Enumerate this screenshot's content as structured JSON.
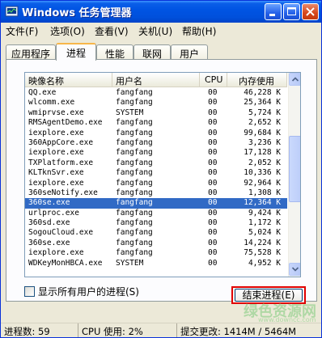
{
  "window": {
    "title": "Windows 任务管理器"
  },
  "title_buttons": {
    "minimize": "minimize-icon",
    "maximize": "maximize-icon",
    "close": "close-icon"
  },
  "menu": [
    "文件(F)",
    "选项(O)",
    "查看(V)",
    "关机(U)",
    "帮助(H)"
  ],
  "tabs": [
    "应用程序",
    "进程",
    "性能",
    "联网",
    "用户"
  ],
  "active_tab": "进程",
  "columns": [
    "映像名称",
    "用户名",
    "CPU",
    "内存使用"
  ],
  "rows": [
    [
      "QQ.exe",
      "fangfang",
      "00",
      "46,228 K"
    ],
    [
      "wlcomm.exe",
      "fangfang",
      "00",
      "25,364 K"
    ],
    [
      "wmiprvse.exe",
      "SYSTEM",
      "00",
      "5,724 K"
    ],
    [
      "RMSAgentDemo.exe",
      "fangfang",
      "00",
      "2,652 K"
    ],
    [
      "iexplore.exe",
      "fangfang",
      "00",
      "99,684 K"
    ],
    [
      "360AppCore.exe",
      "fangfang",
      "00",
      "3,236 K"
    ],
    [
      "iexplore.exe",
      "fangfang",
      "00",
      "17,128 K"
    ],
    [
      "TXPlatform.exe",
      "fangfang",
      "00",
      "2,052 K"
    ],
    [
      "KLTknSvr.exe",
      "fangfang",
      "00",
      "10,336 K"
    ],
    [
      "iexplore.exe",
      "fangfang",
      "00",
      "92,964 K"
    ],
    [
      "360seNotify.exe",
      "fangfang",
      "00",
      "1,308 K"
    ],
    [
      "360se.exe",
      "fangfang",
      "00",
      "12,364 K"
    ],
    [
      "urlproc.exe",
      "fangfang",
      "00",
      "9,424 K"
    ],
    [
      "360sd.exe",
      "fangfang",
      "00",
      "1,172 K"
    ],
    [
      "SogouCloud.exe",
      "fangfang",
      "00",
      "5,024 K"
    ],
    [
      "360se.exe",
      "fangfang",
      "00",
      "14,224 K"
    ],
    [
      "iexplore.exe",
      "fangfang",
      "00",
      "75,528 K"
    ],
    [
      "WDKeyMonHBCA.exe",
      "SYSTEM",
      "00",
      "4,952 K"
    ]
  ],
  "selected_row": 11,
  "show_all_label": "显示所有用户的进程(S)",
  "end_process_label": "结束进程(E)",
  "status": {
    "processes": "进程数: 59",
    "cpu": "CPU 使用: 2%",
    "commit": "提交更改: 1414M / 5464M"
  },
  "watermark": {
    "main": "绿色资源网",
    "sub": "www.downcc.com"
  },
  "colors": {
    "titlebar": "#0054e3",
    "selection": "#316ac5",
    "highlight_border": "#e00000"
  }
}
